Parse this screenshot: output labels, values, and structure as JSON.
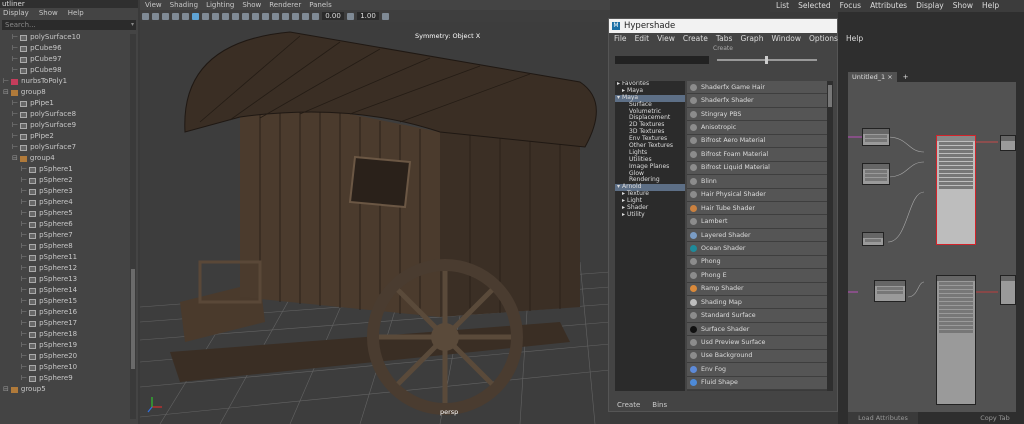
{
  "outliner": {
    "title": "utliner",
    "menu": [
      "Display",
      "Show",
      "Help"
    ],
    "search_placeholder": "Search...",
    "items": [
      {
        "label": "polySurface10",
        "type": "mesh",
        "indent": 1
      },
      {
        "label": "pCube96",
        "type": "mesh",
        "indent": 1
      },
      {
        "label": "pCube97",
        "type": "mesh",
        "indent": 1
      },
      {
        "label": "pCube98",
        "type": "mesh",
        "indent": 1
      },
      {
        "label": "nurbsToPoly1",
        "type": "nurbs",
        "indent": 0
      },
      {
        "label": "group8",
        "type": "group",
        "indent": 0
      },
      {
        "label": "pPipe1",
        "type": "mesh",
        "indent": 1
      },
      {
        "label": "polySurface8",
        "type": "mesh",
        "indent": 1
      },
      {
        "label": "polySurface9",
        "type": "mesh",
        "indent": 1
      },
      {
        "label": "pPipe2",
        "type": "mesh",
        "indent": 1
      },
      {
        "label": "polySurface7",
        "type": "mesh",
        "indent": 1
      },
      {
        "label": "group4",
        "type": "group",
        "indent": 1
      },
      {
        "label": "pSphere1",
        "type": "mesh",
        "indent": 2
      },
      {
        "label": "pSphere2",
        "type": "mesh",
        "indent": 2
      },
      {
        "label": "pSphere3",
        "type": "mesh",
        "indent": 2
      },
      {
        "label": "pSphere4",
        "type": "mesh",
        "indent": 2
      },
      {
        "label": "pSphere5",
        "type": "mesh",
        "indent": 2
      },
      {
        "label": "pSphere6",
        "type": "mesh",
        "indent": 2
      },
      {
        "label": "pSphere7",
        "type": "mesh",
        "indent": 2
      },
      {
        "label": "pSphere8",
        "type": "mesh",
        "indent": 2
      },
      {
        "label": "pSphere11",
        "type": "mesh",
        "indent": 2
      },
      {
        "label": "pSphere12",
        "type": "mesh",
        "indent": 2
      },
      {
        "label": "pSphere13",
        "type": "mesh",
        "indent": 2
      },
      {
        "label": "pSphere14",
        "type": "mesh",
        "indent": 2
      },
      {
        "label": "pSphere15",
        "type": "mesh",
        "indent": 2
      },
      {
        "label": "pSphere16",
        "type": "mesh",
        "indent": 2
      },
      {
        "label": "pSphere17",
        "type": "mesh",
        "indent": 2
      },
      {
        "label": "pSphere18",
        "type": "mesh",
        "indent": 2
      },
      {
        "label": "pSphere19",
        "type": "mesh",
        "indent": 2
      },
      {
        "label": "pSphere20",
        "type": "mesh",
        "indent": 2
      },
      {
        "label": "pSphere10",
        "type": "mesh",
        "indent": 2
      },
      {
        "label": "pSphere9",
        "type": "mesh",
        "indent": 2
      },
      {
        "label": "group5",
        "type": "group",
        "indent": 0
      }
    ]
  },
  "viewport": {
    "menu": [
      "View",
      "Shading",
      "Lighting",
      "Show",
      "Renderer",
      "Panels"
    ],
    "exposure": "0.00",
    "gamma": "1.00",
    "symmetry_label": "Symmetry: Object X",
    "camera_label": "persp"
  },
  "hypershade": {
    "title": "Hypershade",
    "menu": [
      "File",
      "Edit",
      "View",
      "Create",
      "Tabs",
      "Graph",
      "Window",
      "Options",
      "Help"
    ],
    "create_label": "Create",
    "tree": [
      {
        "label": "Favorites",
        "indent": 0,
        "arrow": "▸"
      },
      {
        "label": "Maya",
        "indent": 1,
        "arrow": "▸"
      },
      {
        "label": "Maya",
        "indent": 0,
        "arrow": "▾",
        "selected": true
      },
      {
        "label": "Surface",
        "indent": 2,
        "arrow": ""
      },
      {
        "label": "Volumetric",
        "indent": 2,
        "arrow": ""
      },
      {
        "label": "Displacement",
        "indent": 2,
        "arrow": ""
      },
      {
        "label": "2D Textures",
        "indent": 2,
        "arrow": ""
      },
      {
        "label": "3D Textures",
        "indent": 2,
        "arrow": ""
      },
      {
        "label": "Env Textures",
        "indent": 2,
        "arrow": ""
      },
      {
        "label": "Other Textures",
        "indent": 2,
        "arrow": ""
      },
      {
        "label": "Lights",
        "indent": 2,
        "arrow": ""
      },
      {
        "label": "Utilities",
        "indent": 2,
        "arrow": ""
      },
      {
        "label": "Image Planes",
        "indent": 2,
        "arrow": ""
      },
      {
        "label": "Glow",
        "indent": 2,
        "arrow": ""
      },
      {
        "label": "Rendering",
        "indent": 2,
        "arrow": ""
      },
      {
        "label": "Arnold",
        "indent": 0,
        "arrow": "▾",
        "selected": true
      },
      {
        "label": "Texture",
        "indent": 1,
        "arrow": "▸"
      },
      {
        "label": "Light",
        "indent": 1,
        "arrow": "▸"
      },
      {
        "label": "Shader",
        "indent": 1,
        "arrow": "▸"
      },
      {
        "label": "Utility",
        "indent": 1,
        "arrow": "▸"
      }
    ],
    "shaders": [
      {
        "label": "Shaderfx Game Hair",
        "color": "#8c8c8c"
      },
      {
        "label": "Shaderfx Shader",
        "color": "#8c8c8c"
      },
      {
        "label": "Stingray PBS",
        "color": "#8c8c8c"
      },
      {
        "label": "Anisotropic",
        "color": "#8c8c8c"
      },
      {
        "label": "Bifrost Aero Material",
        "color": "#8c8c8c"
      },
      {
        "label": "Bifrost Foam Material",
        "color": "#8c8c8c"
      },
      {
        "label": "Bifrost Liquid Material",
        "color": "#8c8c8c"
      },
      {
        "label": "Blinn",
        "color": "#8c8c8c"
      },
      {
        "label": "Hair Physical Shader",
        "color": "#8c8c8c"
      },
      {
        "label": "Hair Tube Shader",
        "color": "#c9803f"
      },
      {
        "label": "Lambert",
        "color": "#8c8c8c"
      },
      {
        "label": "Layered Shader",
        "color": "#7a9cc4"
      },
      {
        "label": "Ocean Shader",
        "color": "#1e8a9a"
      },
      {
        "label": "Phong",
        "color": "#8c8c8c"
      },
      {
        "label": "Phong E",
        "color": "#8c8c8c"
      },
      {
        "label": "Ramp Shader",
        "color": "#d9893a"
      },
      {
        "label": "Shading Map",
        "color": "#bdbdbd"
      },
      {
        "label": "Standard Surface",
        "color": "#8c8c8c"
      },
      {
        "label": "Surface Shader",
        "color": "#111111"
      },
      {
        "label": "Usd Preview Surface",
        "color": "#8c8c8c"
      },
      {
        "label": "Use Background",
        "color": "#8c8c8c"
      },
      {
        "label": "Env Fog",
        "color": "#5d8ad8"
      },
      {
        "label": "Fluid Shape",
        "color": "#4d8ad8"
      }
    ],
    "bottom_tabs": [
      "Create",
      "Bins"
    ]
  },
  "right_panel": {
    "menu": [
      "List",
      "Selected",
      "Focus",
      "Attributes",
      "Display",
      "Show",
      "Help"
    ],
    "tab_label": "Untitled_1",
    "tab_close": "×",
    "tab_add": "+",
    "load_attributes": "Load Attributes",
    "copy_tab": "Copy Tab"
  },
  "colors": {
    "accent": "#5ea3d4",
    "selected_node": "#d3232a",
    "title_bar": "#f2f2f2"
  }
}
